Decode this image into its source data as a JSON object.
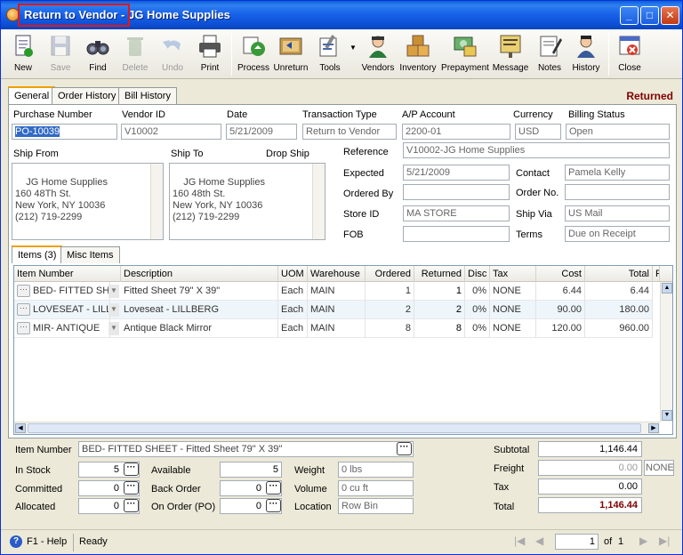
{
  "window": {
    "title": "Return to Vendor - JG Home Supplies"
  },
  "toolbar": [
    {
      "id": "new",
      "label": "New",
      "icon": "new-document-icon",
      "enabled": true
    },
    {
      "id": "save",
      "label": "Save",
      "icon": "save-disk-icon",
      "enabled": false
    },
    {
      "id": "find",
      "label": "Find",
      "icon": "binoculars-icon",
      "enabled": true
    },
    {
      "id": "delete",
      "label": "Delete",
      "icon": "recycle-icon",
      "enabled": false
    },
    {
      "id": "undo",
      "label": "Undo",
      "icon": "undo-arrow-icon",
      "enabled": false
    },
    {
      "id": "print",
      "label": "Print",
      "icon": "printer-icon",
      "enabled": true
    },
    {
      "id": "process",
      "label": "Process",
      "icon": "process-icon",
      "enabled": true
    },
    {
      "id": "unreturn",
      "label": "Unreturn",
      "icon": "unreturn-icon",
      "enabled": true
    },
    {
      "id": "tools",
      "label": "Tools",
      "icon": "tools-icon",
      "enabled": true
    },
    {
      "id": "vendors",
      "label": "Vendors",
      "icon": "vendor-person-icon",
      "enabled": true
    },
    {
      "id": "inventory",
      "label": "Inventory",
      "icon": "boxes-icon",
      "enabled": true
    },
    {
      "id": "prepayment",
      "label": "Prepayment",
      "icon": "prepayment-icon",
      "enabled": true
    },
    {
      "id": "message",
      "label": "Message",
      "icon": "message-board-icon",
      "enabled": true
    },
    {
      "id": "notes",
      "label": "Notes",
      "icon": "notepad-icon",
      "enabled": true
    },
    {
      "id": "history",
      "label": "History",
      "icon": "history-person-icon",
      "enabled": true
    },
    {
      "id": "close",
      "label": "Close",
      "icon": "close-window-icon",
      "enabled": true
    }
  ],
  "tabs": [
    "General",
    "Order History",
    "Bill History"
  ],
  "status_text": "Returned",
  "header": {
    "purchase_number_label": "Purchase Number",
    "purchase_number": "PO-10039",
    "vendor_id_label": "Vendor ID",
    "vendor_id": "V10002",
    "date_label": "Date",
    "date": "5/21/2009",
    "transaction_type_label": "Transaction Type",
    "transaction_type": "Return to Vendor",
    "ap_account_label": "A/P Account",
    "ap_account": "2200-01",
    "currency_label": "Currency",
    "currency": "USD",
    "billing_status_label": "Billing Status",
    "billing_status": "Open"
  },
  "addresses": {
    "ship_from_label": "Ship From",
    "ship_from": "JG Home Supplies\n160 48Th St.\nNew York, NY 10036\n(212) 719-2299",
    "ship_to_label": "Ship To",
    "ship_to": "JG Home Supplies\n160 48th St.\nNew York, NY 10036\n(212) 719-2299",
    "drop_ship_label": "Drop Ship"
  },
  "details": {
    "reference_label": "Reference",
    "reference": "V10002-JG Home Supplies",
    "expected_label": "Expected",
    "expected": "5/21/2009",
    "contact_label": "Contact",
    "contact": "Pamela Kelly",
    "ordered_by_label": "Ordered By",
    "ordered_by": "",
    "order_no_label": "Order No.",
    "order_no": "",
    "store_id_label": "Store ID",
    "store_id": "MA STORE",
    "ship_via_label": "Ship Via",
    "ship_via": "US Mail",
    "fob_label": "FOB",
    "fob": "",
    "terms_label": "Terms",
    "terms": "Due on Receipt"
  },
  "item_tabs": [
    "Items (3)",
    "Misc Items"
  ],
  "grid": {
    "columns": [
      "Item Number",
      "Description",
      "UOM",
      "Warehouse",
      "Ordered",
      "Returned",
      "Disc",
      "Tax",
      "Cost",
      "Total",
      "F"
    ],
    "rows": [
      {
        "item": "BED- FITTED SHE",
        "description": "Fitted Sheet 79\" X 39\"",
        "uom": "Each",
        "warehouse": "MAIN",
        "ordered": "1",
        "returned": "1",
        "disc": "0%",
        "tax": "NONE",
        "cost": "6.44",
        "total": "6.44"
      },
      {
        "item": "LOVESEAT - LILLE",
        "description": "Loveseat - LILLBERG",
        "uom": "Each",
        "warehouse": "MAIN",
        "ordered": "2",
        "returned": "2",
        "disc": "0%",
        "tax": "NONE",
        "cost": "90.00",
        "total": "180.00"
      },
      {
        "item": "MIR- ANTIQUE",
        "description": "Antique Black Mirror",
        "uom": "Each",
        "warehouse": "MAIN",
        "ordered": "8",
        "returned": "8",
        "disc": "0%",
        "tax": "NONE",
        "cost": "120.00",
        "total": "960.00"
      }
    ]
  },
  "bottom": {
    "item_number_label": "Item Number",
    "item_number": "BED- FITTED SHEET - Fitted Sheet 79\" X 39\"",
    "in_stock_label": "In Stock",
    "in_stock": "5",
    "committed_label": "Committed",
    "committed": "0",
    "allocated_label": "Allocated",
    "allocated": "0",
    "available_label": "Available",
    "available": "5",
    "back_order_label": "Back Order",
    "back_order": "0",
    "on_order_label": "On Order (PO)",
    "on_order": "0",
    "weight_label": "Weight",
    "weight": "0 lbs",
    "volume_label": "Volume",
    "volume": "0 cu ft",
    "location_label": "Location",
    "location": "Row  Bin"
  },
  "totals": {
    "subtotal_label": "Subtotal",
    "subtotal": "1,146.44",
    "freight_label": "Freight",
    "freight": "0.00",
    "freight_code": "NONE",
    "tax_label": "Tax",
    "tax": "0.00",
    "total_label": "Total",
    "total": "1,146.44"
  },
  "statusbar": {
    "help": "F1 - Help",
    "status": "Ready",
    "page": "1",
    "of_label": "of",
    "page_count": "1"
  },
  "colors": {
    "title_bar": "#1660e8",
    "status_returned": "#800000",
    "total_value": "#800000",
    "highlight_box": "#e01818"
  }
}
